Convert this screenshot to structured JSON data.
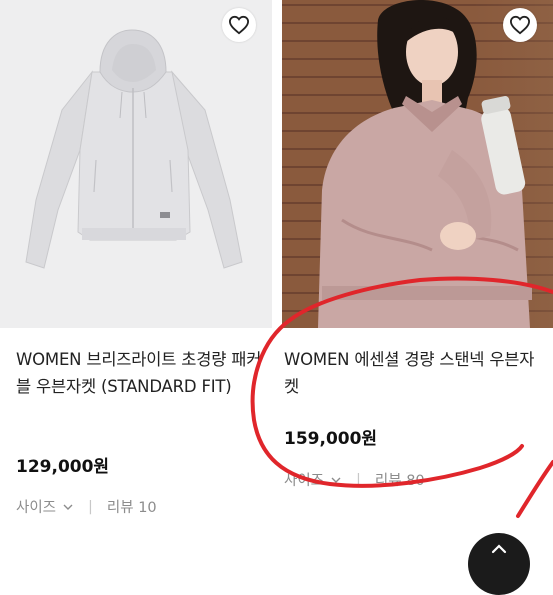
{
  "products": [
    {
      "name": "WOMEN 브리즈라이트 초경량 패커블 우븐자켓 (STANDARD FIT)",
      "price": "129,000원",
      "size_label": "사이즈",
      "review_label": "리뷰 10",
      "image": "light-gray-hooded-jacket"
    },
    {
      "name": "WOMEN 에센셜 경량 스탠넥 우븐자켓",
      "price": "159,000원",
      "size_label": "사이즈",
      "review_label": "리뷰 80",
      "image": "model-in-pink-jacket"
    }
  ],
  "icons": {
    "wishlist": "heart-icon",
    "dropdown": "chevron-down-icon",
    "scroll_top": "chevron-up-icon"
  },
  "colors": {
    "annotation": "#e0262b",
    "price": "#111111",
    "meta": "#8c8c8c"
  }
}
